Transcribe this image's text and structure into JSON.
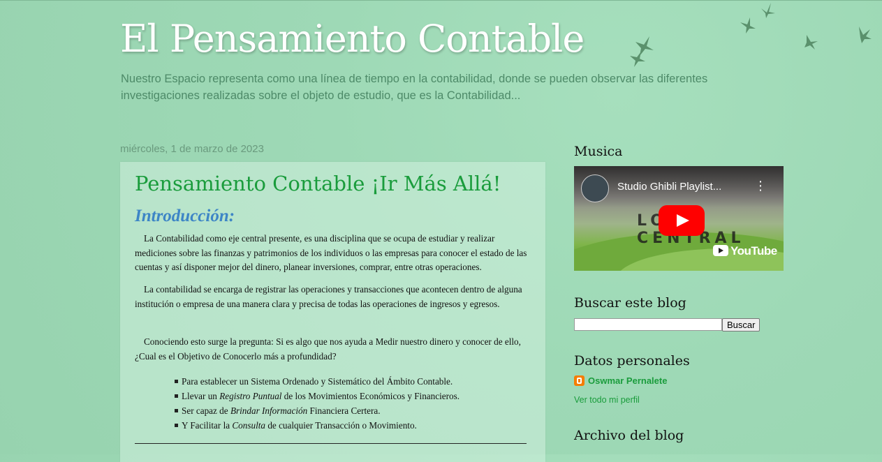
{
  "header": {
    "title": "El Pensamiento Contable",
    "description": "Nuestro Espacio representa como una línea de tiempo en la contabilidad, donde se pueden observar las diferentes investigaciones realizadas sobre el objeto de estudio, que es la Contabilidad..."
  },
  "post": {
    "date": "miércoles, 1 de marzo de 2023",
    "title": "Pensamiento Contable ¡Ir Más Allá!",
    "intro_heading": "Introducción:",
    "paragraphs": [
      "La Contabilidad como eje central presente, es una disciplina que se ocupa de estudiar y realizar mediciones sobre las finanzas y patrimonios de los individuos o las empresas para conocer el estado de las cuentas y así disponer mejor del dinero, planear inversiones, comprar, entre otras operaciones.",
      "La contabilidad se encarga de registrar las operaciones y transacciones que acontecen dentro de alguna institución o empresa de una manera clara y precisa de todas las operaciones de ingresos y egresos.",
      "Conociendo esto surge la pregunta: Si es algo que nos ayuda a Medir nuestro dinero y conocer de ello, ¿Cual es el Objetivo de Conocerlo más a profundidad?"
    ],
    "list": [
      {
        "before": "Para establecer un Sistema Ordenado y Sistemático del Ámbito Contable.",
        "em": "",
        "after": ""
      },
      {
        "before": "Llevar un ",
        "em": "Registro Puntual",
        "after": " de los Movimientos Económicos y Financieros."
      },
      {
        "before": "Ser capaz de ",
        "em": "Brindar Información",
        "after": " Financiera Certera."
      },
      {
        "before": "Y Facilitar la ",
        "em": "Consulta",
        "after": " de cualquier Transacción o Movimiento."
      }
    ]
  },
  "sidebar": {
    "music_title": "Musica",
    "video": {
      "title": "Studio Ghibli Playlist...",
      "overlay_text": "LOFI CENTRAL",
      "brand": "YouTube",
      "menu_icon": "more-vert-icon",
      "play_icon": "youtube-play-icon"
    },
    "search_title": "Buscar este blog",
    "search_input_value": "",
    "search_button": "Buscar",
    "profile_title": "Datos personales",
    "profile_name": "Oswmar Pernalete",
    "profile_icon": "blogger-icon",
    "profile_full": "Ver todo mi perfil",
    "archive_title": "Archivo del blog"
  },
  "colors": {
    "background": "#9ed9b6",
    "title_green": "#1a9c3c",
    "intro_blue": "#3d85c6",
    "description": "#4d8a68"
  }
}
